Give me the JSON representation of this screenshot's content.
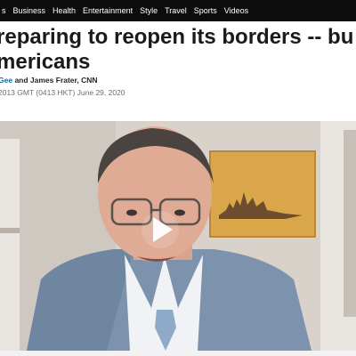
{
  "nav": {
    "items": [
      "s",
      "Business",
      "Health",
      "Entertainment",
      "Style",
      "Travel",
      "Sports",
      "Videos"
    ]
  },
  "article": {
    "headline_line1": "reparing to reopen its borders -- bu",
    "headline_line2": "mericans",
    "byline_prefix": "Gee",
    "byline_and": " and ",
    "byline_author2": "James Frater, CNN",
    "dateline": "2013 GMT (0413 HKT) June 29, 2020"
  },
  "video": {
    "play_icon": "play-icon"
  },
  "colors": {
    "nav_bg": "#0c0c0c",
    "headline": "#1a1a1a",
    "link": "#0c6aa6"
  }
}
